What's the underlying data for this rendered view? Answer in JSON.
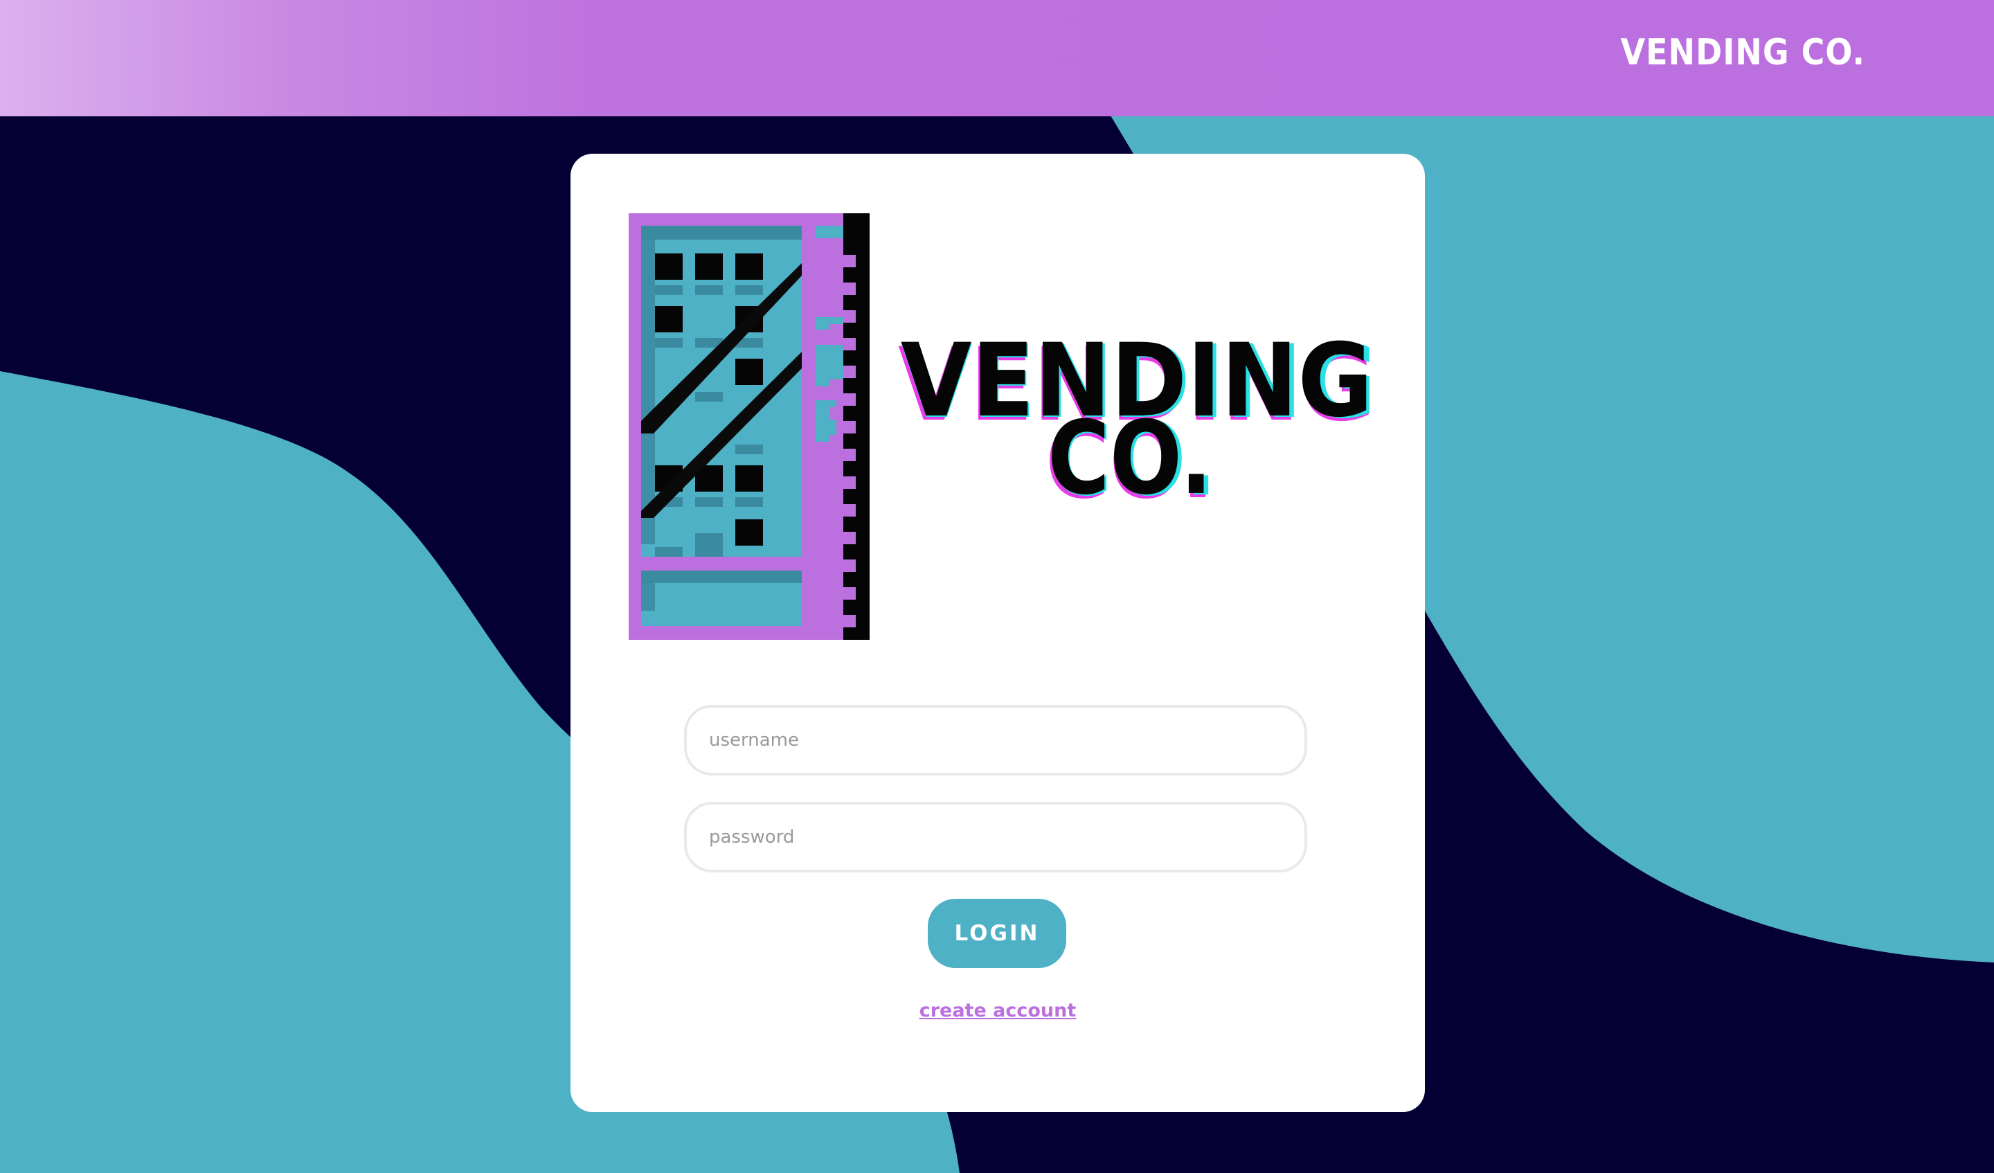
{
  "header": {
    "brand": "VENDING CO."
  },
  "logo": {
    "line1": "VENDING",
    "line2": "CO."
  },
  "form": {
    "username_placeholder": "username",
    "password_placeholder": "password",
    "login_label": "LOGIN",
    "create_account_label": "create account"
  },
  "icons": {
    "logo": "vending-machine-icon"
  },
  "colors": {
    "accent_purple": "#bc6fdf",
    "accent_teal": "#4fb1c6",
    "background_navy": "#050033"
  }
}
